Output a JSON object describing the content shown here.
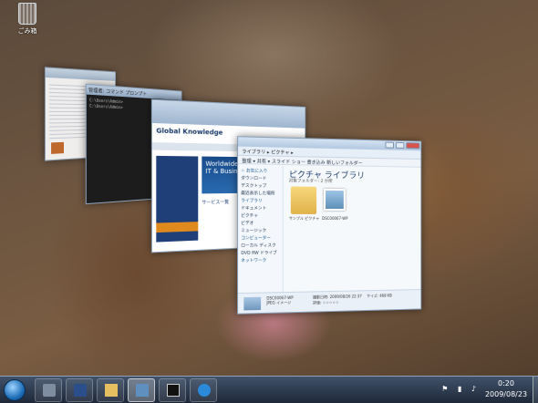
{
  "desktop": {
    "recycle_bin_label": "ごみ箱"
  },
  "explorer": {
    "library_title": "ピクチャ ライブラリ",
    "library_sub": "対象フォルダー: 2 か所",
    "address": "ライブラリ ▸ ピクチャ ▸",
    "toolbar": "整理 ▾   共有 ▾   スライド ショー   書き込み   新しいフォルダー",
    "nav": [
      {
        "label": "☆ お気に入り",
        "head": true
      },
      {
        "label": "ダウンロード",
        "head": false
      },
      {
        "label": "デスクトップ",
        "head": false
      },
      {
        "label": "最近表示した場所",
        "head": false
      },
      {
        "label": "ライブラリ",
        "head": true
      },
      {
        "label": "ドキュメント",
        "head": false
      },
      {
        "label": "ピクチャ",
        "head": false
      },
      {
        "label": "ビデオ",
        "head": false
      },
      {
        "label": "ミュージック",
        "head": false
      },
      {
        "label": "コンピューター",
        "head": true
      },
      {
        "label": "ローカル ディスク",
        "head": false
      },
      {
        "label": "DVD RW ドライブ",
        "head": false
      },
      {
        "label": "ネットワーク",
        "head": true
      }
    ],
    "folder_label": "サンプル ピクチャ",
    "photo_label": "DSC00067-WP",
    "details_name": "DSC00067-WP",
    "details_type": "JPEG イメージ",
    "details_date": "撮影日時: 2009/08/26 22:37",
    "details_rating": "評価: ☆☆☆☆☆",
    "details_size": "サイズ: 468 KB"
  },
  "browser": {
    "site": "Global Knowledge",
    "banner_line1": "Worldwide",
    "banner_line2": "IT & Business",
    "side_label": "サービス一覧"
  },
  "cmd": {
    "title": "管理者: コマンド プロンプト",
    "line1": "C:\\Users\\Admin>",
    "line2": "C:\\Users\\Admin>"
  },
  "clock": {
    "time": "0:20",
    "date": "2009/08/23"
  },
  "taskbar": {
    "active_index": 3
  }
}
